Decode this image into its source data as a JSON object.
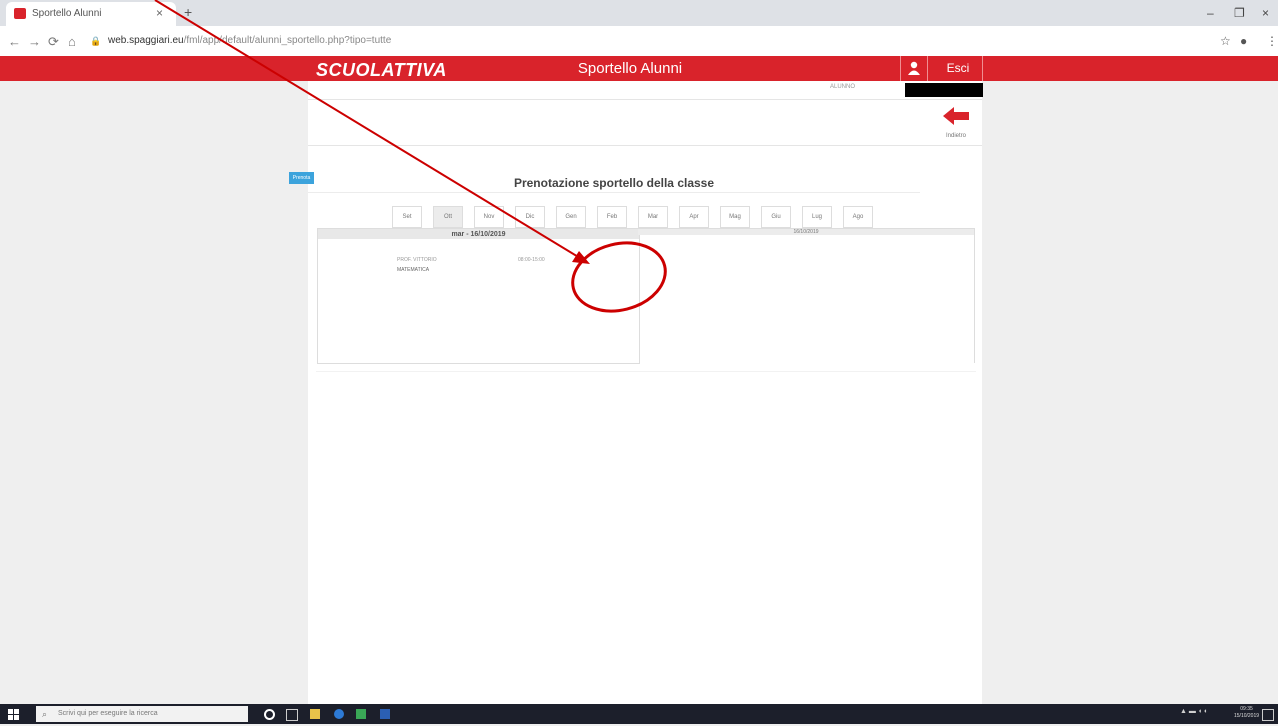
{
  "browser": {
    "tab_title": "Sportello Alunni",
    "tab_close": "×",
    "new_tab": "+",
    "url_host": "web.spaggiari.eu",
    "url_path": "/fml/app/default/alunni_sportello.php?tipo=tutte",
    "window_controls": [
      "–",
      "❐",
      "×"
    ]
  },
  "site": {
    "logo_text": "SCUOLATTIVA",
    "title": "Sportello Alunni",
    "logout_label": "Esci",
    "user_info": "ALUNNO",
    "back_label": "Indietro",
    "brand_color": "#d9232b"
  },
  "booking": {
    "heading": "Prenotazione sportello della classe",
    "months": [
      "Set",
      "Ott",
      "Nov",
      "Dic",
      "Gen",
      "Feb",
      "Mar",
      "Apr",
      "Mag",
      "Giu",
      "Lug",
      "Ago"
    ],
    "active_month": "Ott",
    "left_date": "mar - 16/10/2019",
    "slot_teacher": "PROF. VITTORIO",
    "slot_time": "08:00-15:00",
    "slot_subject": "MATEMATICA",
    "book_label": "Prenota",
    "right_date": "16/10/2019"
  },
  "taskbar": {
    "search_placeholder": "Scrivi qui per eseguire la ricerca",
    "clock_time": "09:35",
    "clock_date": "15/10/2019"
  },
  "annotation": {
    "color": "#cc0000"
  }
}
